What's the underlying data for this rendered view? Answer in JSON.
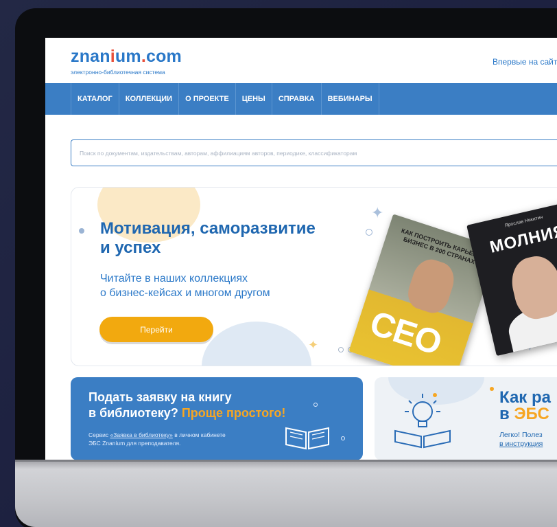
{
  "header": {
    "logo_text_a": "znan",
    "logo_text_b": "ium",
    "logo_text_c": "com",
    "logo_sub": "электронно-библиотечная система",
    "first_time_link": "Впервые на сайт"
  },
  "nav": {
    "items": [
      "КАТАЛОГ",
      "КОЛЛЕКЦИИ",
      "О ПРОЕКТЕ",
      "ЦЕНЫ",
      "СПРАВКА",
      "ВЕБИНАРЫ"
    ]
  },
  "search": {
    "placeholder": "Поиск по документам, издательствам, авторам, аффилиациям авторов, периодике, классификаторам"
  },
  "banner": {
    "title_line1": "Мотивация, саморазвитие",
    "title_line2": "и успех",
    "text_line1": "Читайте в наших коллекциях",
    "text_line2": "о бизнес-кейсах и многом другом",
    "button": "Перейти",
    "book1_title": "КАК ПОСТРОИТЬ КАРЬЕРУ, БИЗНЕС В 200 СТРАНАХ",
    "book1_brand": "CEO",
    "book2_author": "Ярослав Никитин",
    "book2_title": "МОЛНИЯ"
  },
  "card_request": {
    "title_line1": "Подать заявку на книгу",
    "title_line2_a": "в библиотеку?",
    "title_line2_b": "Проще простого!",
    "sub_a": "Сервис",
    "sub_link": "«Заявка в библиотеку»",
    "sub_b": "в личном кабинете",
    "sub_line2": "ЭБС Znanium для преподавателя."
  },
  "card_howto": {
    "title_a": "Как ра",
    "title_b": "в",
    "title_ebs": "ЭБС",
    "sub_line1": "Легко! Полез",
    "sub_line2": "в инструкция"
  }
}
